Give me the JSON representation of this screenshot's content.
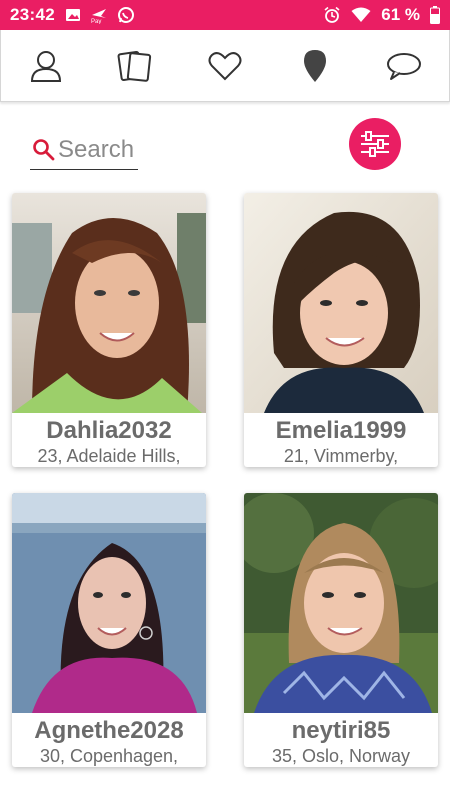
{
  "status_bar": {
    "time": "23:42",
    "battery": "61 %",
    "icons_left": [
      "image-icon",
      "airline-pay-icon",
      "whatsapp-icon"
    ],
    "icons_right": [
      "alarm-icon",
      "wifi-icon",
      "battery-icon"
    ],
    "color": "#ea1e63"
  },
  "nav": {
    "items": [
      {
        "name": "profile",
        "icon": "person-icon"
      },
      {
        "name": "cards",
        "icon": "cards-icon"
      },
      {
        "name": "favorites",
        "icon": "heart-icon"
      },
      {
        "name": "location",
        "icon": "location-pin-icon"
      },
      {
        "name": "messages",
        "icon": "chat-bubble-icon"
      }
    ]
  },
  "search": {
    "placeholder": "Search",
    "icon": "search-icon",
    "accent": "#d81b3a"
  },
  "filter": {
    "icon": "sliders-icon",
    "color": "#ea1e63"
  },
  "profiles": [
    {
      "name": "Dahlia2032",
      "location": "23, Adelaide Hills,"
    },
    {
      "name": "Emelia1999",
      "location": "21, Vimmerby,"
    },
    {
      "name": "Agnethe2028",
      "location": "30, Copenhagen,"
    },
    {
      "name": "neytiri85",
      "location": "35, Oslo, Norway"
    }
  ]
}
